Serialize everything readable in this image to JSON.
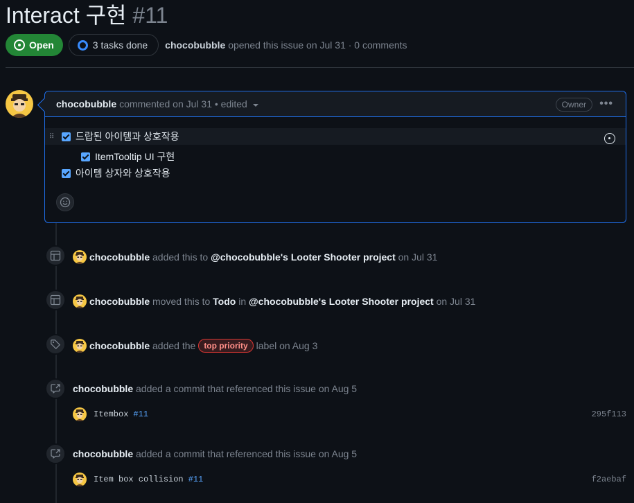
{
  "issue": {
    "title": "Interact 구현",
    "number": "#11",
    "state": "Open",
    "tasks": "3 tasks done",
    "author": "chocobubble",
    "opened_text": "opened this issue on Jul 31 · 0 comments"
  },
  "comment": {
    "author": "chocobubble",
    "meta": "commented on Jul 31 • edited",
    "role": "Owner",
    "tasks": [
      {
        "label": "드랍된 아이템과 상호작용",
        "checked": true
      },
      {
        "label": "ItemTooltip UI 구현",
        "checked": true
      },
      {
        "label": "아이템 상자와 상호작용",
        "checked": true
      }
    ]
  },
  "timeline": [
    {
      "user": "chocobubble",
      "verb": "added this to",
      "target": "@chocobubble's Looter Shooter project",
      "date": "on Jul 31"
    },
    {
      "user": "chocobubble",
      "verb": "moved this to",
      "column": "Todo",
      "in_word": "in",
      "target": "@chocobubble's Looter Shooter project",
      "date": "on Jul 31"
    },
    {
      "user": "chocobubble",
      "verb": "added the",
      "label": "top priority",
      "tail": "label on Aug 3"
    },
    {
      "user": "chocobubble",
      "verb": "added a commit that referenced this issue on Aug 5",
      "commit_msg": "Itembox",
      "commit_ref": "#11",
      "sha": "295f113"
    },
    {
      "user": "chocobubble",
      "verb": "added a commit that referenced this issue on Aug 5",
      "commit_msg": "Item box collision",
      "commit_ref": "#11",
      "sha": "f2aebaf"
    }
  ],
  "colors": {
    "background": "#0d1117",
    "open_green": "#238636",
    "accent_blue": "#1f6feb",
    "label_red": "#da3633"
  }
}
